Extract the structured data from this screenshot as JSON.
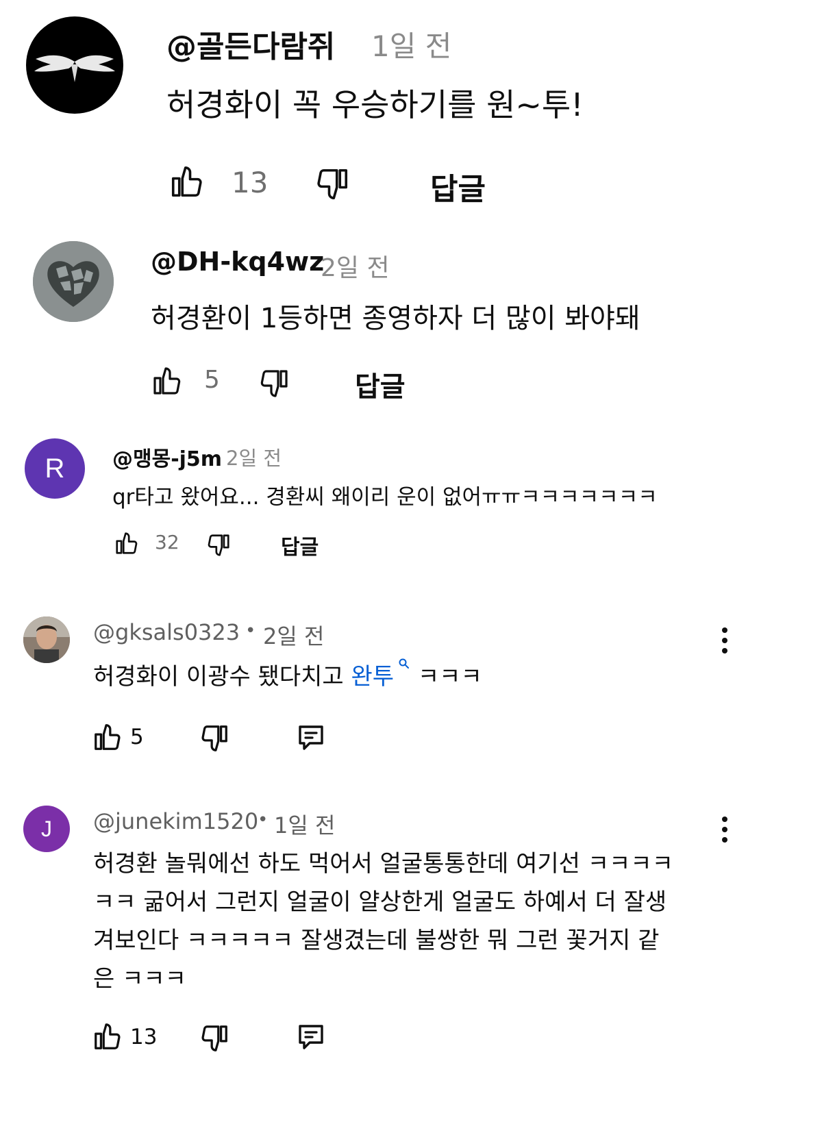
{
  "comments": [
    {
      "author": "@골든다람쥐",
      "time": "1일 전",
      "text": "허경화이 꼭 우승하기를 원~투!",
      "likes": "13",
      "reply_label": "답글"
    },
    {
      "author": "@DH-kq4wz",
      "time": "2일 전",
      "text": "허경환이 1등하면 종영하자 더 많이 봐야돼",
      "likes": "5",
      "reply_label": "답글"
    },
    {
      "author": "@맹몽-j5m",
      "time": "2일 전",
      "avatar_letter": "R",
      "avatar_color": "#5e35b1",
      "text": "qr타고 왔어요... 경환씨 왜이리 운이 없어ㅠㅠㅋㅋㅋㅋㅋㅋㅋ",
      "likes": "32",
      "reply_label": "답글"
    },
    {
      "author": "@gksals0323",
      "separator": "•",
      "time": "2일 전",
      "text_before": "허경화이 이광수 됐다치고 ",
      "link_text": "완투",
      "text_after": " ㅋㅋㅋ",
      "likes": "5"
    },
    {
      "author": "@junekim1520",
      "separator": "•",
      "time": "1일 전",
      "avatar_letter": "J",
      "avatar_color": "#7b2fa8",
      "text_lines": [
        "허경환 놀뭐에선 하도 먹어서 얼굴통통한데 여기선 ㅋㅋㅋㅋ",
        "ㅋㅋ 굶어서 그런지 얼굴이 얄상한게 얼굴도 하예서 더 잘생",
        "겨보인다 ㅋㅋㅋㅋㅋ 잘생겼는데 불쌍한 뭐 그런 꽃거지 같",
        "은 ㅋㅋㅋ"
      ],
      "likes": "13"
    }
  ],
  "colors": {
    "link": "#065fd4",
    "muted": "#606060"
  },
  "icons": {
    "like": "thumbs-up-icon",
    "dislike": "thumbs-down-icon",
    "reply": "comment-reply-icon",
    "menu": "more-vertical-icon",
    "search": "search-icon"
  }
}
